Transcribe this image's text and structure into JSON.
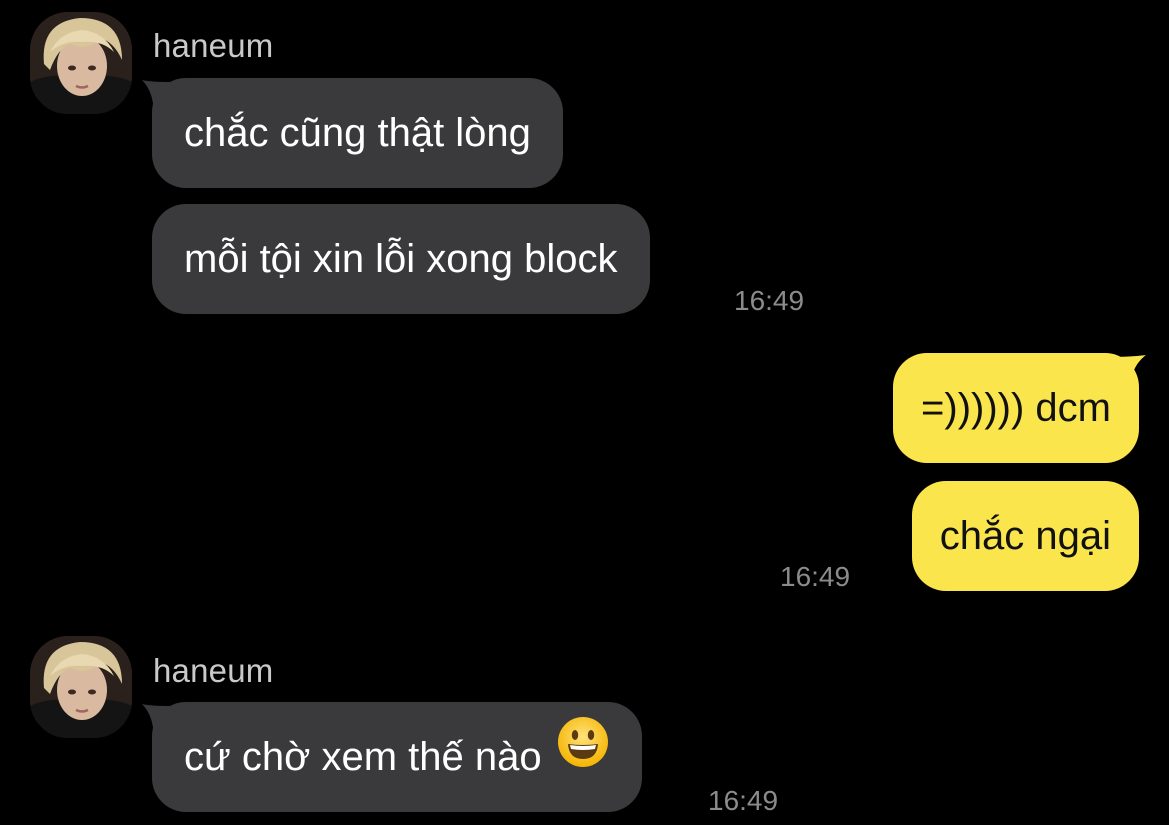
{
  "messages": [
    {
      "direction": "incoming",
      "sender": "haneum",
      "bubbles": [
        "chắc cũng thật lòng",
        "mỗi tội xin lỗi xong block"
      ],
      "time": "16:49"
    },
    {
      "direction": "outgoing",
      "bubbles": [
        "=)))))) dcm",
        "chắc ngại"
      ],
      "time": "16:49"
    },
    {
      "direction": "incoming",
      "sender": "haneum",
      "bubbles": [
        "cứ chờ xem thế nào"
      ],
      "emoji": "grinning-face-emoji",
      "time": "16:49"
    }
  ],
  "colors": {
    "background": "#000000",
    "incoming_bubble": "#3a3a3c",
    "outgoing_bubble": "#fae64c",
    "timestamp": "#8b8b8b",
    "sender_name": "#c9c9c9"
  }
}
